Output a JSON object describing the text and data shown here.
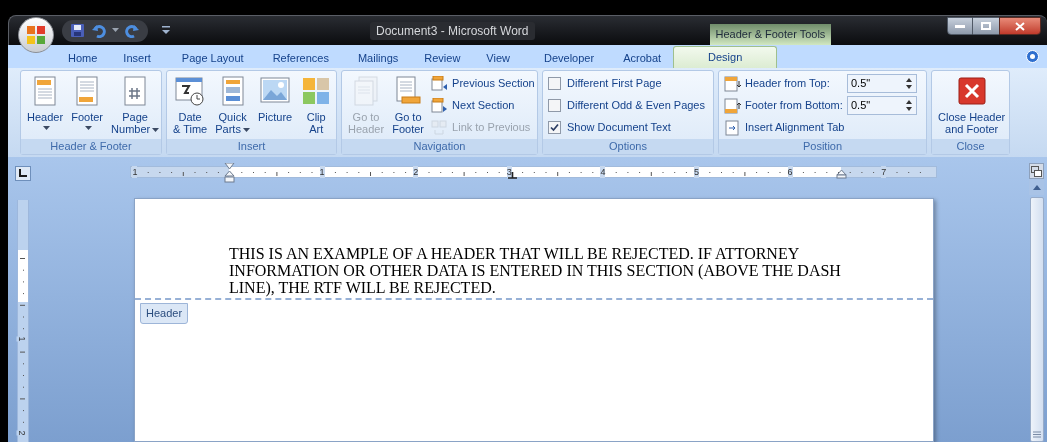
{
  "title_bar": {
    "title": "Document3 - Microsoft Word",
    "contextual_label": "Header & Footer Tools"
  },
  "tabs": [
    {
      "label": "Home",
      "selected": false
    },
    {
      "label": "Insert",
      "selected": false
    },
    {
      "label": "Page Layout",
      "selected": false
    },
    {
      "label": "References",
      "selected": false
    },
    {
      "label": "Mailings",
      "selected": false
    },
    {
      "label": "Review",
      "selected": false
    },
    {
      "label": "View",
      "selected": false
    },
    {
      "label": "Developer",
      "selected": false
    },
    {
      "label": "Acrobat",
      "selected": false
    },
    {
      "label": "Design",
      "selected": true
    }
  ],
  "ribbon_groups": [
    {
      "label": "Header & Footer",
      "items": [
        {
          "kind": "large",
          "lines": [
            "Header"
          ],
          "dropdown": true,
          "disabled": false
        },
        {
          "kind": "large",
          "lines": [
            "Footer"
          ],
          "dropdown": true,
          "disabled": false
        },
        {
          "kind": "large",
          "lines": [
            "Page",
            "Number"
          ],
          "dropdown": true,
          "disabled": false
        }
      ]
    },
    {
      "label": "Insert",
      "items": [
        {
          "kind": "large",
          "lines": [
            "Date",
            "& Time"
          ],
          "dropdown": false,
          "disabled": false
        },
        {
          "kind": "large",
          "lines": [
            "Quick",
            "Parts"
          ],
          "dropdown": true,
          "disabled": false
        },
        {
          "kind": "large",
          "lines": [
            "Picture"
          ],
          "dropdown": false,
          "disabled": false
        },
        {
          "kind": "large",
          "lines": [
            "Clip",
            "Art"
          ],
          "dropdown": false,
          "disabled": false
        }
      ]
    },
    {
      "label": "Navigation",
      "items": [
        {
          "kind": "large",
          "lines": [
            "Go to",
            "Header"
          ],
          "dropdown": false,
          "disabled": true
        },
        {
          "kind": "large",
          "lines": [
            "Go to",
            "Footer"
          ],
          "dropdown": false,
          "disabled": false
        },
        {
          "kind": "small",
          "label": "Previous Section",
          "disabled": false
        },
        {
          "kind": "small",
          "label": "Next Section",
          "disabled": false
        },
        {
          "kind": "small",
          "label": "Link to Previous",
          "disabled": true
        }
      ]
    },
    {
      "label": "Options",
      "items": [
        {
          "kind": "checkbox",
          "label": "Different First Page",
          "checked": false
        },
        {
          "kind": "checkbox",
          "label": "Different Odd & Even Pages",
          "checked": false
        },
        {
          "kind": "checkbox",
          "label": "Show Document Text",
          "checked": true
        }
      ]
    },
    {
      "label": "Position",
      "items": [
        {
          "kind": "spin",
          "label": "Header from Top:",
          "value": "0.5\""
        },
        {
          "kind": "spin",
          "label": "Footer from Bottom:",
          "value": "0.5\""
        },
        {
          "kind": "small",
          "label": "Insert Alignment Tab",
          "disabled": false
        }
      ]
    },
    {
      "label": "Close",
      "items": [
        {
          "kind": "large",
          "lines": [
            "Close Header",
            "and Footer"
          ],
          "dropdown": false,
          "disabled": false
        }
      ]
    }
  ],
  "ruler": {
    "horizontal_numbers": [
      "1",
      "1",
      "2",
      "3",
      "4",
      "5",
      "6",
      "7"
    ],
    "vertical_numbers": [
      "1",
      "2"
    ]
  },
  "document": {
    "header_text": "THIS IS AN EXAMPLE OF A HEADER THAT WILL BE REJECTED. IF ATTORNEY INFORMATION OR OTHER DATA IS ENTERED IN THIS SECTION (ABOVE THE DASH LINE), THE RTF WILL BE REJECTED.",
    "header_tag": "Header"
  }
}
